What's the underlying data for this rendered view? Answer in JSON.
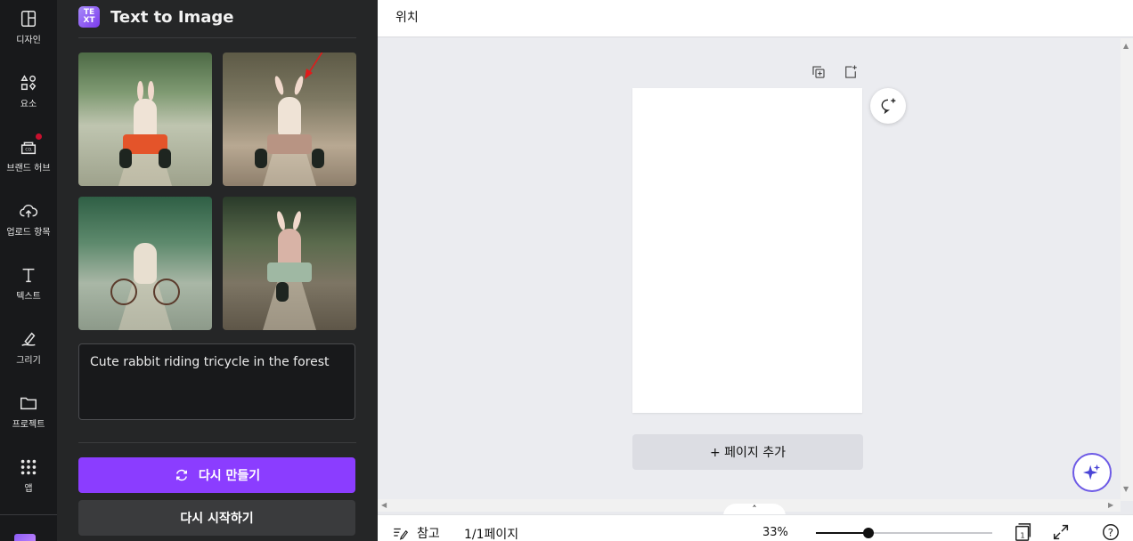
{
  "rail": {
    "items": [
      {
        "label": "디자인",
        "icon": "layout-icon"
      },
      {
        "label": "요소",
        "icon": "shapes-icon"
      },
      {
        "label": "브랜드 허브",
        "icon": "brand-hub-icon"
      },
      {
        "label": "업로드 항목",
        "icon": "cloud-upload-icon"
      },
      {
        "label": "텍스트",
        "icon": "text-icon"
      },
      {
        "label": "그리기",
        "icon": "draw-icon"
      },
      {
        "label": "프로젝트",
        "icon": "folder-icon"
      },
      {
        "label": "앱",
        "icon": "apps-grid-icon"
      }
    ]
  },
  "panel": {
    "title": "Text to Image",
    "app_icon_text": "TE XT",
    "images": [
      {
        "alt": "rabbit on orange tricycle in forest"
      },
      {
        "alt": "rabbit on pedal car in forest"
      },
      {
        "alt": "child on tricycle on forest road"
      },
      {
        "alt": "rabbit on green tricycle in forest"
      }
    ],
    "prompt": "Cute rabbit riding tricycle in the forest",
    "regenerate_label": "다시 만들기",
    "restart_label": "다시 시작하기"
  },
  "topbar": {
    "position_label": "위치"
  },
  "canvas": {
    "add_page_label": "+ 페이지 추가"
  },
  "bottombar": {
    "notes_label": "참고",
    "pages_label": "1/1페이지",
    "zoom_label": "33%",
    "zoom_level_fraction": 0.3,
    "page_count_badge": "1",
    "help_label": "?"
  },
  "colors": {
    "accent": "#8b3dff",
    "rail_bg": "#18191b",
    "panel_bg": "#252627",
    "canvas_bg": "#ebecf0"
  }
}
